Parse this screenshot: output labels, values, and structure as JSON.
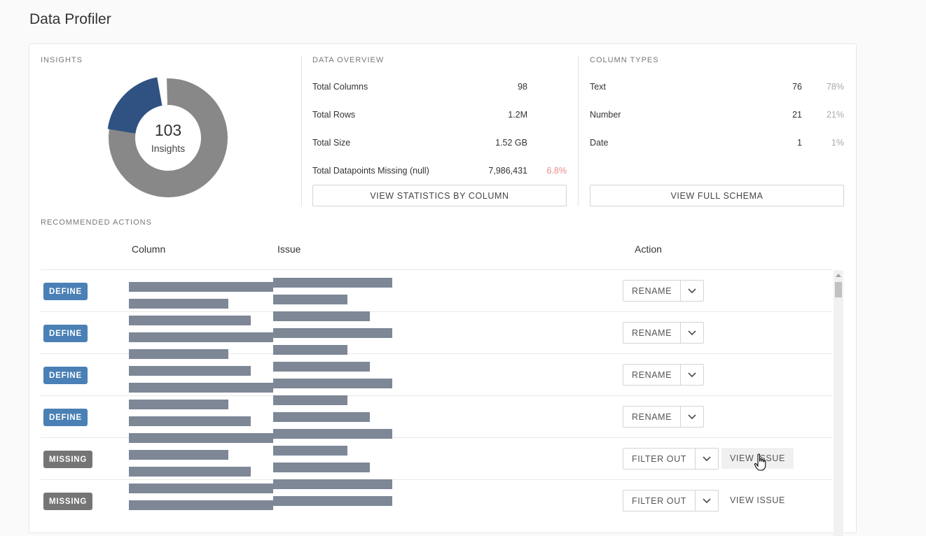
{
  "page": {
    "title": "Data Profiler"
  },
  "insights": {
    "label": "INSIGHTS",
    "count": "103",
    "count_label": "Insights",
    "colors": {
      "primary": "#2f5282",
      "secondary": "#888888"
    }
  },
  "overview": {
    "label": "DATA OVERVIEW",
    "rows": [
      {
        "label": "Total Columns",
        "value": "98"
      },
      {
        "label": "Total Rows",
        "value": "1.2M"
      },
      {
        "label": "Total Size",
        "value": "1.52 GB"
      },
      {
        "label": "Total Datapoints Missing (null)",
        "value": "7,986,431",
        "pct": "6.8%"
      }
    ],
    "button": "VIEW STATISTICS BY COLUMN"
  },
  "column_types": {
    "label": "COLUMN TYPES",
    "rows": [
      {
        "label": "Text",
        "value": "76",
        "pct": "78%"
      },
      {
        "label": "Number",
        "value": "21",
        "pct": "21%"
      },
      {
        "label": "Date",
        "value": "1",
        "pct": "1%"
      }
    ],
    "button": "VIEW FULL SCHEMA"
  },
  "recommended": {
    "label": "RECOMMENDED ACTIONS",
    "headers": {
      "column": "Column",
      "issue": "Issue",
      "action": "Action"
    },
    "rows": [
      {
        "badge": "DEFINE",
        "action": "RENAME",
        "secondary": ""
      },
      {
        "badge": "DEFINE",
        "action": "RENAME",
        "secondary": ""
      },
      {
        "badge": "DEFINE",
        "action": "RENAME",
        "secondary": ""
      },
      {
        "badge": "DEFINE",
        "action": "RENAME",
        "secondary": ""
      },
      {
        "badge": "MISSING",
        "action": "FILTER OUT",
        "secondary": "VIEW ISSUE"
      },
      {
        "badge": "MISSING",
        "action": "FILTER OUT",
        "secondary": "VIEW ISSUE"
      }
    ]
  },
  "colors": {
    "define": "#4a80b5",
    "missing": "#757575",
    "redacted": "#7d8796",
    "alert": "#e98b8b"
  }
}
